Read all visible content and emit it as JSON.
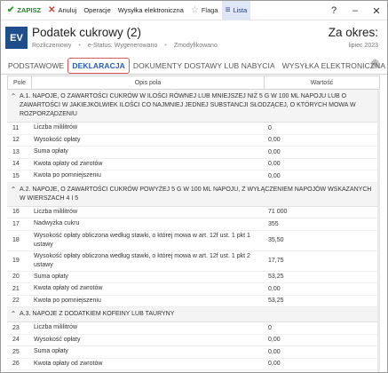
{
  "toolbar": {
    "save": "ZAPISZ",
    "cancel": "Anuluj",
    "operations": "Operacje",
    "send": "Wysyłka elektroniczna",
    "flag": "Flaga",
    "list": "Lista"
  },
  "window_controls": {
    "help": "?",
    "minimize": "–",
    "close": "✕"
  },
  "header": {
    "badge": "EV",
    "title": "Podatek cukrowy (2)",
    "status1": "Rozliczeniowy",
    "status2": "e-Status: Wygenerowano",
    "status3": "Zmodyfikowano",
    "period_label": "Za okres:",
    "period_value": "lipiec 2023"
  },
  "tabs": [
    "PODSTAWOWE",
    "DEKLARACJA",
    "DOKUMENTY DOSTAWY LUB NABYCIA",
    "WYSYŁKA ELEKTRONICZNA"
  ],
  "table": {
    "headers": {
      "pole": "Pole",
      "opis": "Opis pola",
      "wartosc": "Wartość"
    },
    "blocks": [
      {
        "section": "A.1. NAPOJE, O ZAWARTOŚCI CUKRÓW W ILOŚCI RÓWNEJ LUB MNIEJSZEJ NIŻ 5 G W 100 ML NAPOJU LUB O ZAWARTOŚCI W JAKIEJKOLWIEK ILOŚCI CO NAJMNIEJ JEDNEJ SUBSTANCJI SŁODZĄCEJ, O KTÓRYCH MOWA W ROZPORZĄDZENIU",
        "rows": [
          {
            "pole": "11",
            "opis": "Liczba mililitrów",
            "wartosc": "0"
          },
          {
            "pole": "12",
            "opis": "Wysokość opłaty",
            "wartosc": "0,00"
          },
          {
            "pole": "13",
            "opis": "Suma opłaty",
            "wartosc": "0,00"
          },
          {
            "pole": "14",
            "opis": "Kwota opłaty od zwrotów",
            "wartosc": "0,00"
          },
          {
            "pole": "15",
            "opis": "Kwota po pomniejszeniu",
            "wartosc": "0,00"
          }
        ]
      },
      {
        "section": "A.2. NAPOJE, O ZAWARTOŚCI CUKRÓW POWYŻEJ 5 G W 100 ML NAPOJU, Z WYŁĄCZENIEM NAPOJÓW WSKAZANYCH W WIERSZACH 4 I 5",
        "rows": [
          {
            "pole": "16",
            "opis": "Liczba mililitrów",
            "wartosc": "71 000"
          },
          {
            "pole": "17",
            "opis": "Nadwyżka cukru",
            "wartosc": "355"
          },
          {
            "pole": "18",
            "opis": "Wysokość opłaty obliczona według stawki, o której mowa w art. 12f ust. 1 pkt 1 ustawy",
            "wartosc": "35,50"
          },
          {
            "pole": "19",
            "opis": "Wysokość opłaty obliczona według stawki, o której mowa w art. 12f ust. 1 pkt 2 ustawy",
            "wartosc": "17,75"
          },
          {
            "pole": "20",
            "opis": "Suma opłaty",
            "wartosc": "53,25"
          },
          {
            "pole": "21",
            "opis": "Kwota opłaty od zwrotów",
            "wartosc": "0,00"
          },
          {
            "pole": "22",
            "opis": "Kwota po pomniejszeniu",
            "wartosc": "53,25"
          }
        ]
      },
      {
        "section": "A.3. NAPOJE Z DODATKIEM KOFEINY LUB TAURYNY",
        "rows": [
          {
            "pole": "23",
            "opis": "Liczba mililitrów",
            "wartosc": "0"
          },
          {
            "pole": "24",
            "opis": "Wysokość opłaty",
            "wartosc": "0,00"
          },
          {
            "pole": "25",
            "opis": "Suma opłaty",
            "wartosc": "0,00"
          },
          {
            "pole": "26",
            "opis": "Kwota opłaty od zwrotów",
            "wartosc": "0,00"
          },
          {
            "pole": "27",
            "opis": "Kwota po pomniejszeniu",
            "wartosc": "0,00"
          }
        ]
      }
    ]
  },
  "colors": {
    "accent": "#1f4e8c",
    "active_tab": "#2a5bb5",
    "active_tab_border": "#e05a5a",
    "save": "#2a9d2a",
    "cancel": "#d23b3b"
  }
}
